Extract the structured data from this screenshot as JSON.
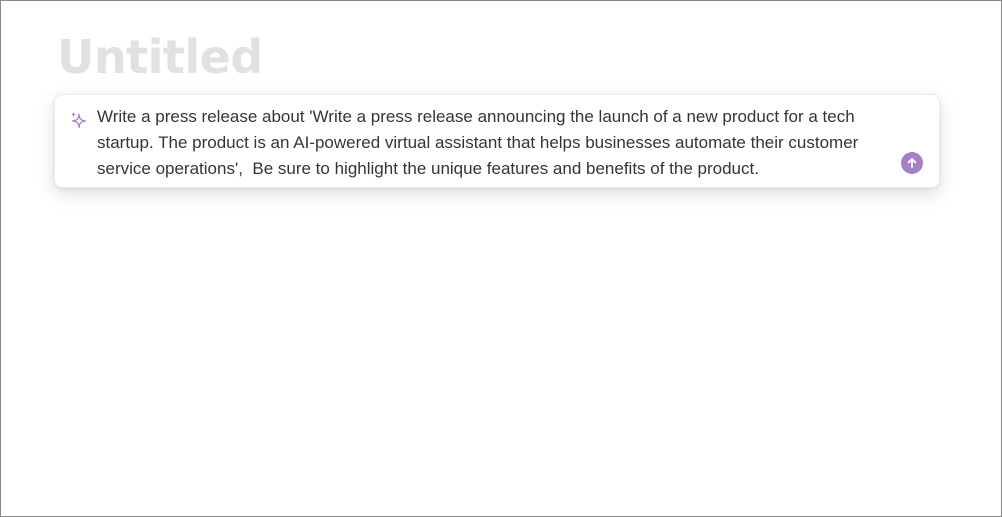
{
  "document": {
    "title": "Untitled"
  },
  "ai_prompt": {
    "text": "Write a press release about 'Write a press release announcing the launch of a new product for a tech startup. The product is an AI-powered virtual assistant that helps businesses automate their customer service operations',  Be sure to highlight the unique features and benefits of the product.",
    "leading_icon": "sparkle-icon",
    "submit_icon": "arrow-up-icon"
  },
  "colors": {
    "title_placeholder": "#e1e1e1",
    "accent": "#a67fc9",
    "text": "#37352f"
  }
}
